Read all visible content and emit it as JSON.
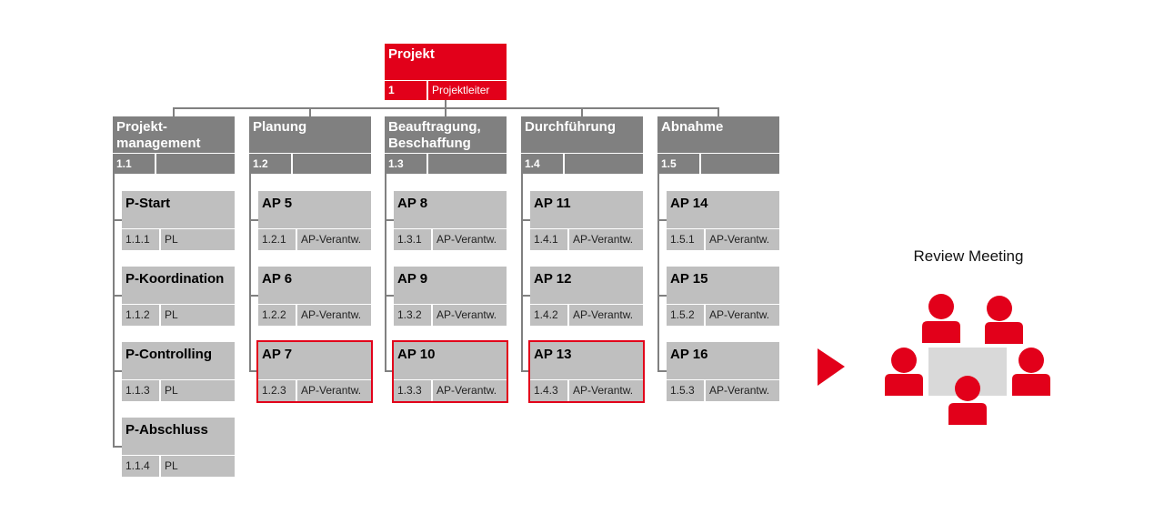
{
  "colors": {
    "accent": "#e2001a",
    "header_gray": "#808080",
    "package_gray": "#bfbfbf",
    "table_gray": "#d9d9d9",
    "connector": "#808080"
  },
  "root": {
    "title": "Projekt",
    "number": "1",
    "owner": "Projektleiter"
  },
  "columns": [
    {
      "title": "Projekt-\nmanagement",
      "number": "1.1",
      "owner": "",
      "children": [
        {
          "title": "P-Start",
          "number": "1.1.1",
          "owner": "PL",
          "highlighted": false
        },
        {
          "title": "P-Koordination",
          "number": "1.1.2",
          "owner": "PL",
          "highlighted": false
        },
        {
          "title": "P-Controlling",
          "number": "1.1.3",
          "owner": "PL",
          "highlighted": false
        },
        {
          "title": "P-Abschluss",
          "number": "1.1.4",
          "owner": "PL",
          "highlighted": false
        }
      ]
    },
    {
      "title": "Planung",
      "number": "1.2",
      "owner": "",
      "children": [
        {
          "title": "AP 5",
          "number": "1.2.1",
          "owner": "AP-Verantw.",
          "highlighted": false
        },
        {
          "title": "AP 6",
          "number": "1.2.2",
          "owner": "AP-Verantw.",
          "highlighted": false
        },
        {
          "title": "AP 7",
          "number": "1.2.3",
          "owner": "AP-Verantw.",
          "highlighted": true
        }
      ]
    },
    {
      "title": "Beauftragung,\nBeschaffung",
      "number": "1.3",
      "owner": "",
      "children": [
        {
          "title": "AP 8",
          "number": "1.3.1",
          "owner": "AP-Verantw.",
          "highlighted": false
        },
        {
          "title": "AP 9",
          "number": "1.3.2",
          "owner": "AP-Verantw.",
          "highlighted": false
        },
        {
          "title": "AP 10",
          "number": "1.3.3",
          "owner": "AP-Verantw.",
          "highlighted": true
        }
      ]
    },
    {
      "title": "Durchführung",
      "number": "1.4",
      "owner": "",
      "children": [
        {
          "title": "AP 11",
          "number": "1.4.1",
          "owner": "AP-Verantw.",
          "highlighted": false
        },
        {
          "title": "AP 12",
          "number": "1.4.2",
          "owner": "AP-Verantw.",
          "highlighted": false
        },
        {
          "title": "AP 13",
          "number": "1.4.3",
          "owner": "AP-Verantw.",
          "highlighted": true
        }
      ]
    },
    {
      "title": "Abnahme",
      "number": "1.5",
      "owner": "",
      "children": [
        {
          "title": "AP 14",
          "number": "1.5.1",
          "owner": "AP-Verantw.",
          "highlighted": false
        },
        {
          "title": "AP 15",
          "number": "1.5.2",
          "owner": "AP-Verantw.",
          "highlighted": false
        },
        {
          "title": "AP 16",
          "number": "1.5.3",
          "owner": "AP-Verantw.",
          "highlighted": false
        }
      ]
    }
  ],
  "review": {
    "label": "Review Meeting",
    "arrow_icon": "triangle-right-icon",
    "people_icon": "person-icon",
    "participants": 5
  }
}
